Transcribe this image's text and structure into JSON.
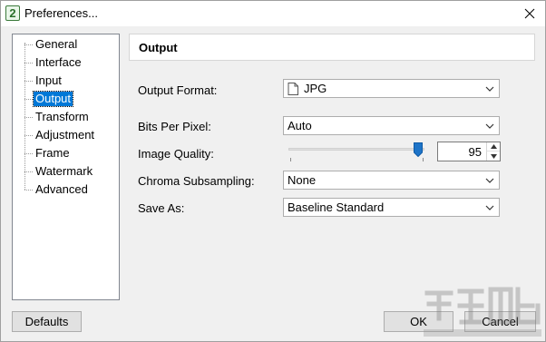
{
  "window": {
    "title": "Preferences...",
    "app_icon_glyph": "2",
    "close_glyph": "✕"
  },
  "nav": {
    "items": [
      {
        "label": "General"
      },
      {
        "label": "Interface"
      },
      {
        "label": "Input"
      },
      {
        "label": "Output"
      },
      {
        "label": "Transform"
      },
      {
        "label": "Adjustment"
      },
      {
        "label": "Frame"
      },
      {
        "label": "Watermark"
      },
      {
        "label": "Advanced"
      }
    ],
    "selected": "Output"
  },
  "output": {
    "header": "Output",
    "format": {
      "label": "Output Format:",
      "value": "JPG",
      "icon": "file-icon"
    },
    "bits": {
      "label": "Bits Per Pixel:",
      "value": "Auto"
    },
    "quality": {
      "label": "Image Quality:",
      "value": "95",
      "slider_fraction": 0.95
    },
    "chroma": {
      "label": "Chroma Subsampling:",
      "value": "None"
    },
    "save_as": {
      "label": "Save As:",
      "value": "Baseline Standard"
    }
  },
  "buttons": {
    "defaults": "Defaults",
    "ok": "OK",
    "cancel": "Cancel"
  },
  "colors": {
    "selection": "#0078d7",
    "slider_thumb": "#1e74c8"
  }
}
